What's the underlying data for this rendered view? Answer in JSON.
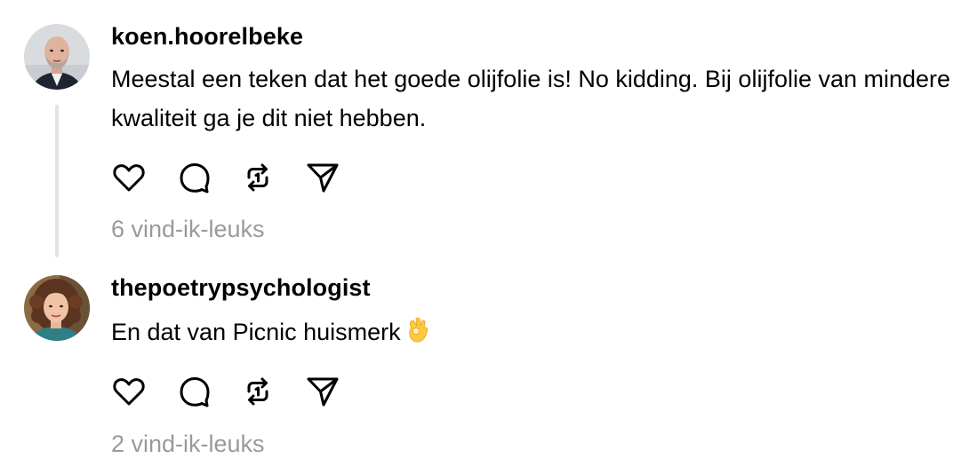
{
  "comments": [
    {
      "username": "koen.hoorelbeke",
      "avatar_icon": "bald-man-avatar",
      "text": "Meestal een teken dat het goede olijfolie is! No kidding. Bij olijfolie van mindere kwaliteit ga je dit niet hebben.",
      "likes": "6 vind-ik-leuks",
      "actions": [
        "heart-icon",
        "comment-icon",
        "repost-icon",
        "share-icon"
      ]
    },
    {
      "username": "thepoetrypsychologist",
      "avatar_icon": "curly-hair-woman-avatar",
      "text": "En dat van Picnic huismerk",
      "emoji": "ok-hand-emoji",
      "likes": "2 vind-ik-leuks",
      "actions": [
        "heart-icon",
        "comment-icon",
        "repost-icon",
        "share-icon"
      ]
    }
  ],
  "colors": {
    "text": "#000000",
    "muted": "#9a9a9a",
    "thread_line": "#e3e3e3"
  }
}
